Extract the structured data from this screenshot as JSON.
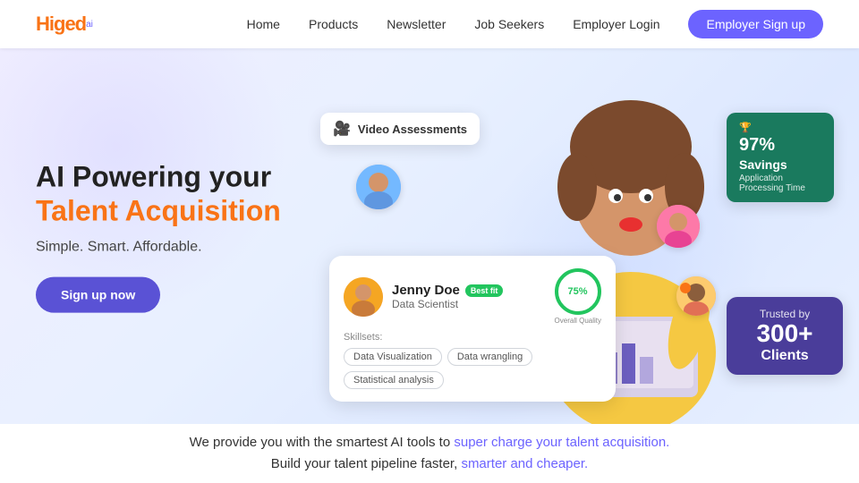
{
  "brand": {
    "name": "Higed",
    "superscript": "ai"
  },
  "navbar": {
    "links": [
      "Home",
      "Products",
      "Newsletter",
      "Job Seekers"
    ],
    "login_label": "Employer Login",
    "signup_label": "Employer Sign up"
  },
  "hero": {
    "title_part1": "AI Powering your ",
    "title_highlight": "Talent Acquisition",
    "subtitle": "Simple. Smart. Affordable.",
    "cta_label": "Sign up now"
  },
  "card_video": {
    "label": "Video Assessments"
  },
  "card_savings": {
    "percent": "97%",
    "label": "Savings",
    "sublabel": "Application Processing Time"
  },
  "card_trusted": {
    "label": "Trusted by",
    "number": "300+",
    "clients": "Clients"
  },
  "card_jenny": {
    "name": "Jenny Doe",
    "badge": "Best fit",
    "title": "Data Scientist",
    "quality_percent": "75%",
    "quality_label": "Overall Quality",
    "skills_label": "Skillsets:",
    "skills": [
      "Data Visualization",
      "Data wrangling",
      "Statistical analysis"
    ]
  },
  "bottom": {
    "line1_prefix": "We provide you with the smartest AI tools to ",
    "line1_accent": "super charge your talent acquisition.",
    "line2_prefix": "Build your talent pipeline faster, ",
    "line2_accent": "smarter and cheaper."
  }
}
